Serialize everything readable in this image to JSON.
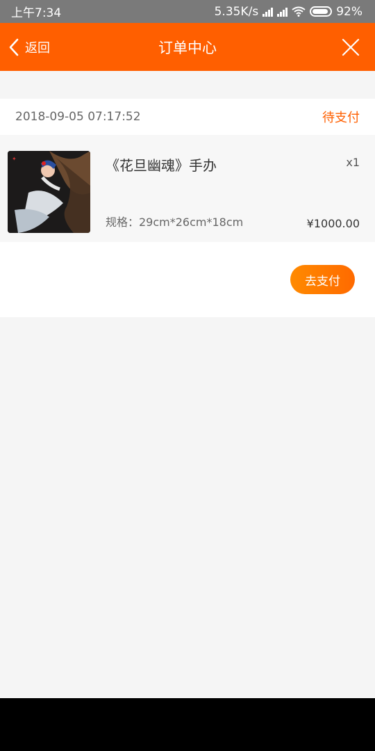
{
  "status_bar": {
    "time": "上午7:34",
    "net_speed": "5.35K/s",
    "battery": "92%",
    "battery_level": 0.92
  },
  "nav": {
    "back_label": "返回",
    "title": "订单中心",
    "close_icon": "close-icon"
  },
  "order": {
    "datetime": "2018-09-05 07:17:52",
    "status": "待支付",
    "item": {
      "title": "《花旦幽魂》手办",
      "qty": "x1",
      "spec": "规格：29cm*26cm*18cm",
      "price": "¥1000.00"
    },
    "pay_button": "去支付"
  },
  "colors": {
    "brand_orange": "#ff5f00",
    "status_bar": "#7a7a7a",
    "background": "#f5f5f5"
  }
}
